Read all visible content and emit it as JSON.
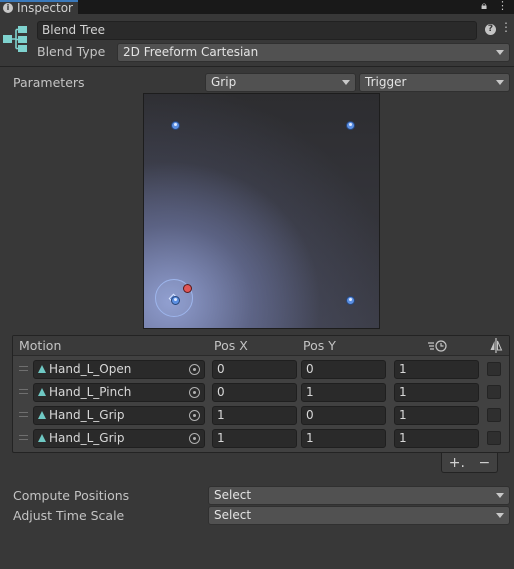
{
  "tab": {
    "title": "Inspector",
    "lock_icon": "lock-icon",
    "menu_icon": "kebab-menu-icon"
  },
  "header": {
    "icon": "blend-tree-icon",
    "name": "Blend Tree",
    "blend_type_label": "Blend Type",
    "blend_type_value": "2D Freeform Cartesian"
  },
  "parameters": {
    "label": "Parameters",
    "param_x": "Grip",
    "param_y": "Trigger"
  },
  "graph": {
    "x_range": [
      0,
      1
    ],
    "y_range": [
      0,
      1
    ],
    "motion_points": [
      {
        "x": 0,
        "y": 0
      },
      {
        "x": 0,
        "y": 1
      },
      {
        "x": 1,
        "y": 0
      },
      {
        "x": 1,
        "y": 1
      }
    ],
    "point_color": "#5b8fe2",
    "current_marker_color": "#e05656"
  },
  "motion_list": {
    "header": {
      "motion": "Motion",
      "pos_x": "Pos X",
      "pos_y": "Pos Y",
      "time_icon": "time-scale-icon",
      "mirror_icon": "mirror-icon"
    },
    "rows": [
      {
        "name": "Hand_L_Open",
        "pos_x": "0",
        "pos_y": "0",
        "time": "1"
      },
      {
        "name": "Hand_L_Pinch",
        "pos_x": "0",
        "pos_y": "1",
        "time": "1"
      },
      {
        "name": "Hand_L_Grip",
        "pos_x": "1",
        "pos_y": "0",
        "time": "1"
      },
      {
        "name": "Hand_L_Grip",
        "pos_x": "1",
        "pos_y": "1",
        "time": "1"
      }
    ],
    "add_label": "+.",
    "remove_label": "−"
  },
  "compute_positions": {
    "label": "Compute Positions",
    "value": "Select"
  },
  "adjust_time_scale": {
    "label": "Adjust Time Scale",
    "value": "Select"
  },
  "colors": {
    "accent": "#3a79bb",
    "panel": "#383838",
    "field": "#2a2a2a"
  }
}
